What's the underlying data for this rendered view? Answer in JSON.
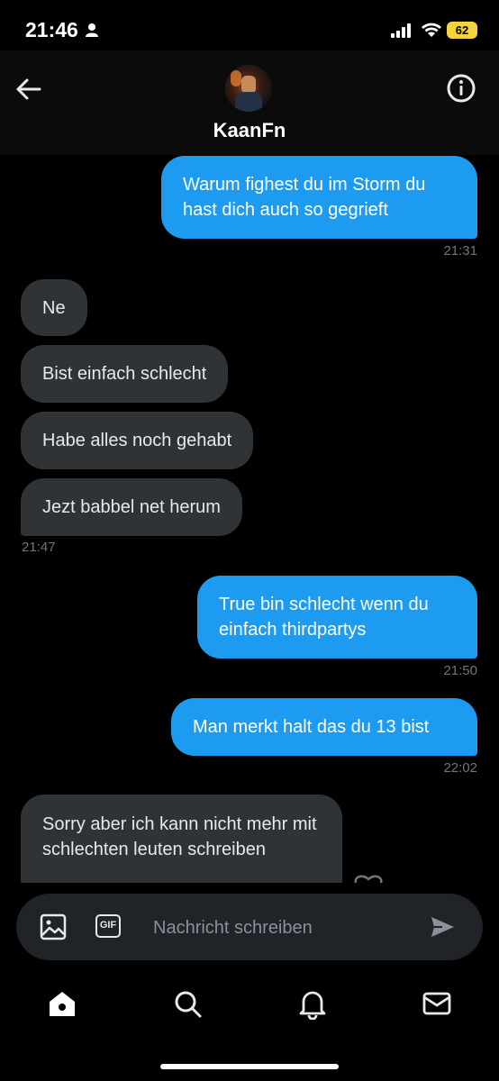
{
  "status_bar": {
    "time": "21:46",
    "battery": "62"
  },
  "header": {
    "username": "KaanFn"
  },
  "messages": [
    {
      "text": "Warum fighest du im Storm du hast dich auch so gegrieft",
      "time": "21:31"
    },
    {
      "text": "Ne"
    },
    {
      "text": "Bist einfach schlecht"
    },
    {
      "text": "Habe alles noch gehabt"
    },
    {
      "text": "Jezt babbel net herum",
      "time": "21:47"
    },
    {
      "text": "True bin schlecht wenn du einfach thirdpartys",
      "time": "21:50"
    },
    {
      "text": "Man merkt halt das du 13 bist",
      "time": "22:02"
    },
    {
      "text": "Sorry aber ich kann nicht mehr mit schlechten leuten schreiben"
    }
  ],
  "composer": {
    "placeholder": "Nachricht schreiben",
    "gif_label": "GIF"
  },
  "icons": [
    "back-arrow-icon",
    "info-icon",
    "image-icon",
    "gif-icon",
    "send-icon",
    "home-icon",
    "search-icon",
    "bell-icon",
    "mail-icon"
  ],
  "colors": {
    "outgoing": "#1d9bf0",
    "incoming": "#2f3336",
    "background": "#000000"
  }
}
